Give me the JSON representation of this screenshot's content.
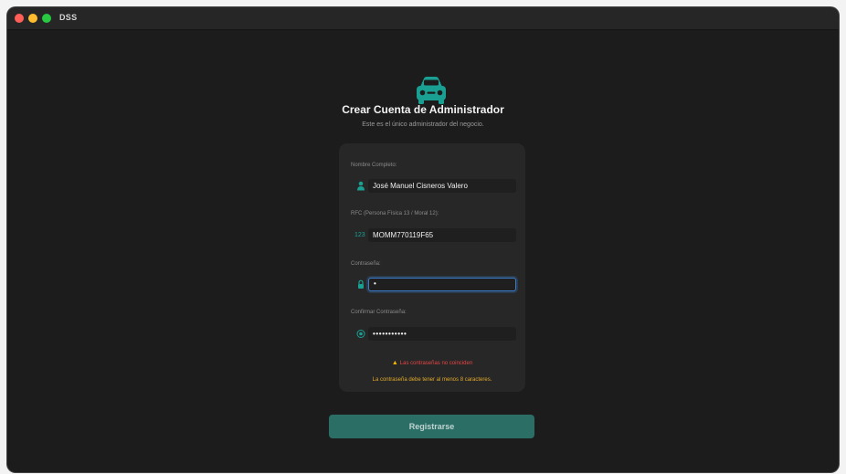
{
  "window": {
    "title": "DSS"
  },
  "header": {
    "logo_icon": "car-icon",
    "title": "Crear Cuenta de Administrador",
    "subtitle": "Este es el único administrador del negocio."
  },
  "form": {
    "name": {
      "label": "Nombre Completo:",
      "icon": "person-icon",
      "value": "José Manuel Cisneros Valero"
    },
    "rfc": {
      "label": "RFC (Persona Física 13 / Moral 12):",
      "icon_text": "123",
      "value": "MOMM770119F65"
    },
    "password": {
      "label": "Contraseña:",
      "icon": "lock-icon",
      "value": "•"
    },
    "confirm_password": {
      "label": "Confirmar Contraseña:",
      "icon": "check-circle-icon",
      "value": "•••••••••••"
    },
    "warning_text": "Las contraseñas no coinciden",
    "hint_text": "La contraseña debe tener al menos 8 caracteres."
  },
  "actions": {
    "submit_label": "Registrarse"
  },
  "colors": {
    "accent": "#1aa093",
    "error": "#e64545",
    "warning": "#e0a92a",
    "button": "#2a6e66"
  }
}
